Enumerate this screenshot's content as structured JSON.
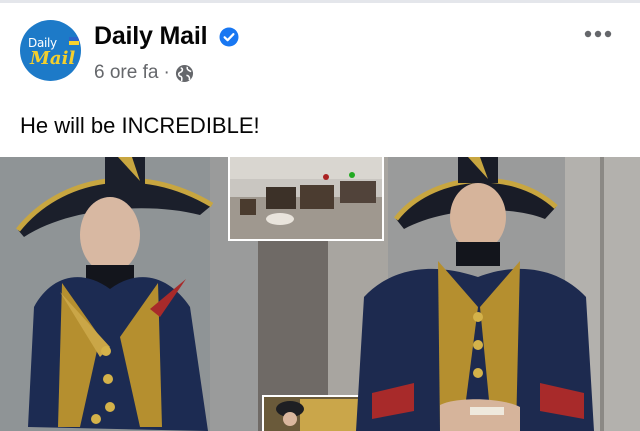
{
  "post": {
    "page_name": "Daily Mail",
    "avatar_text_line1": "Daily",
    "avatar_text_line2": "Mail",
    "timestamp": "6 ore fa",
    "separator": "·",
    "audience_icon": "globe-icon",
    "verified_icon": "verified-badge-icon",
    "more_icon": "more-options-icon",
    "caption": "He will be INCREDIBLE!"
  },
  "media": {
    "description_icon": "photo-collage"
  },
  "colors": {
    "brand_blue": "#1d7ac8",
    "brand_yellow": "#f3cf2d",
    "verified_blue": "#1877f2",
    "secondary_text": "#65676b"
  }
}
